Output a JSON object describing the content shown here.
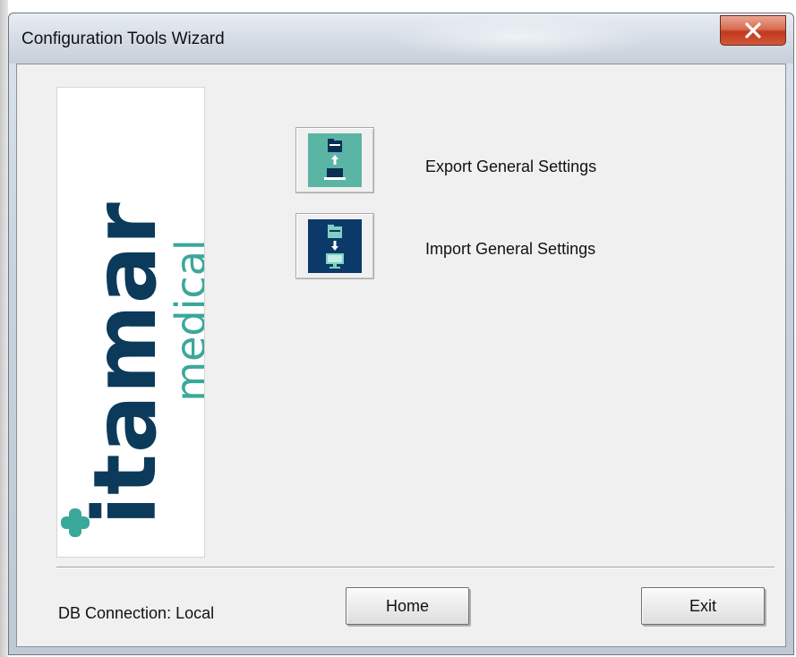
{
  "window": {
    "title": "Configuration Tools Wizard",
    "close_label": "close"
  },
  "logo": {
    "main_text": "itamar",
    "sub_text": "medical",
    "main_color": "#0b3a5a",
    "accent_color": "#3aa89a"
  },
  "actions": [
    {
      "label": "Export General Settings",
      "icon": "export-settings-icon",
      "tile_color": "#5ab5a5"
    },
    {
      "label": "Import General Settings",
      "icon": "import-settings-icon",
      "tile_color": "#0b3a6a"
    }
  ],
  "footer": {
    "db_status": "DB Connection: Local",
    "home_label": "Home",
    "exit_label": "Exit"
  }
}
